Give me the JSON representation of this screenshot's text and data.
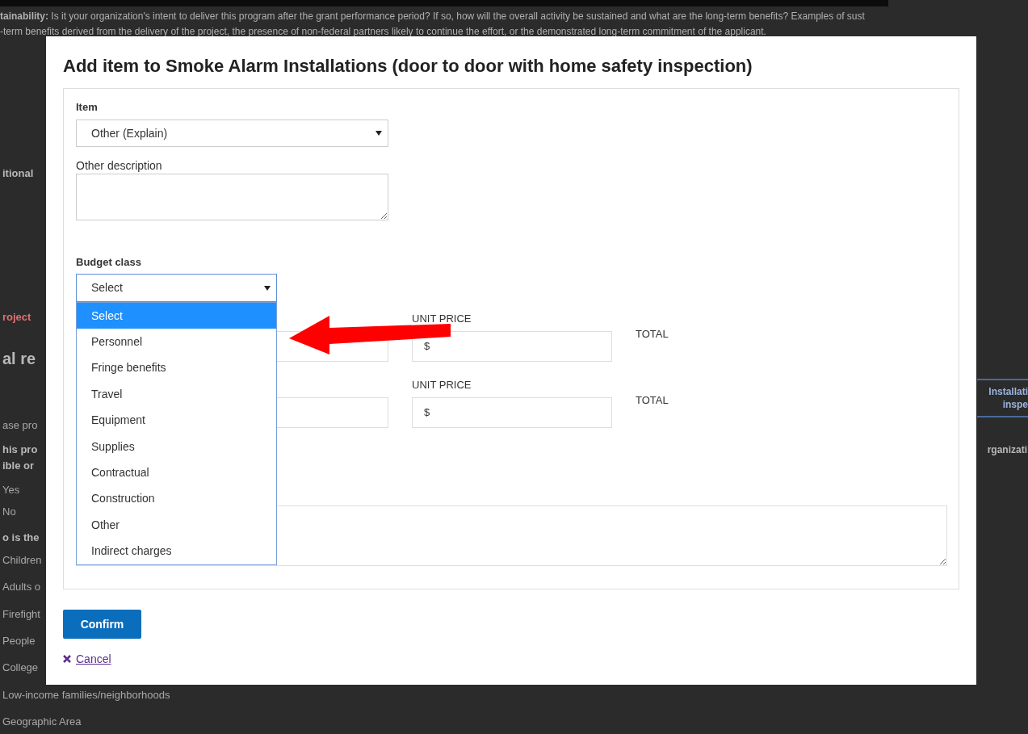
{
  "background_page": {
    "intro_lines": [
      "**tainability:** Is it your organization's intent to deliver this program after the grant performance period? If so, how will the overall activity be sustained and what are the long-term benefits? Examples of sust",
      "-term benefits derived from the delivery of the project, the presence of non-federal partners likely to continue the effort, or the demonstrated long-term commitment of the applicant."
    ],
    "left_column": [
      {
        "kind": "heading",
        "text": "itional"
      },
      {
        "kind": "alert",
        "text": "roject"
      },
      {
        "kind": "title",
        "text": "al re"
      },
      {
        "kind": "text",
        "text": "ase pro"
      },
      {
        "kind": "heading",
        "text": "his pro"
      },
      {
        "kind": "heading",
        "text": "ible or"
      },
      {
        "kind": "option",
        "text": "Yes"
      },
      {
        "kind": "option",
        "text": "No"
      },
      {
        "kind": "heading",
        "text": "o is the"
      },
      {
        "kind": "option",
        "text": "Children"
      },
      {
        "kind": "option",
        "text": "Adults o"
      },
      {
        "kind": "option",
        "text": "Firefight"
      },
      {
        "kind": "option",
        "text": "People"
      },
      {
        "kind": "option",
        "text": "College"
      },
      {
        "kind": "option",
        "text": "Low-income families/neighborhoods"
      },
      {
        "kind": "option",
        "text": "Geographic Area"
      }
    ],
    "right_column": {
      "tab_lines": [
        "Installati",
        "inspe"
      ],
      "text": "rganizati"
    }
  },
  "dialog": {
    "title": "Add item to Smoke Alarm Installations (door to door with home safety inspection)",
    "item": {
      "label": "Item",
      "value": "Other (Explain)"
    },
    "other_description": {
      "label": "Other description"
    },
    "budget_class": {
      "label": "Budget class",
      "value": "Select",
      "expanded": true,
      "options": [
        {
          "label": "Select",
          "selected": true
        },
        {
          "label": "Personnel",
          "selected": false
        },
        {
          "label": "Fringe benefits",
          "selected": false
        },
        {
          "label": "Travel",
          "selected": false
        },
        {
          "label": "Equipment",
          "selected": false
        },
        {
          "label": "Supplies",
          "selected": false
        },
        {
          "label": "Contractual",
          "selected": false
        },
        {
          "label": "Construction",
          "selected": false
        },
        {
          "label": "Other",
          "selected": false
        },
        {
          "label": "Indirect charges",
          "selected": false
        }
      ]
    },
    "line_rows": [
      {
        "unit_price_label": "UNIT PRICE",
        "currency_symbol": "$",
        "total_label": "TOTAL"
      },
      {
        "unit_price_label": "UNIT PRICE",
        "currency_symbol": "$",
        "total_label": "TOTAL"
      }
    ],
    "confirm_button": "Confirm",
    "cancel_link": "Cancel"
  }
}
